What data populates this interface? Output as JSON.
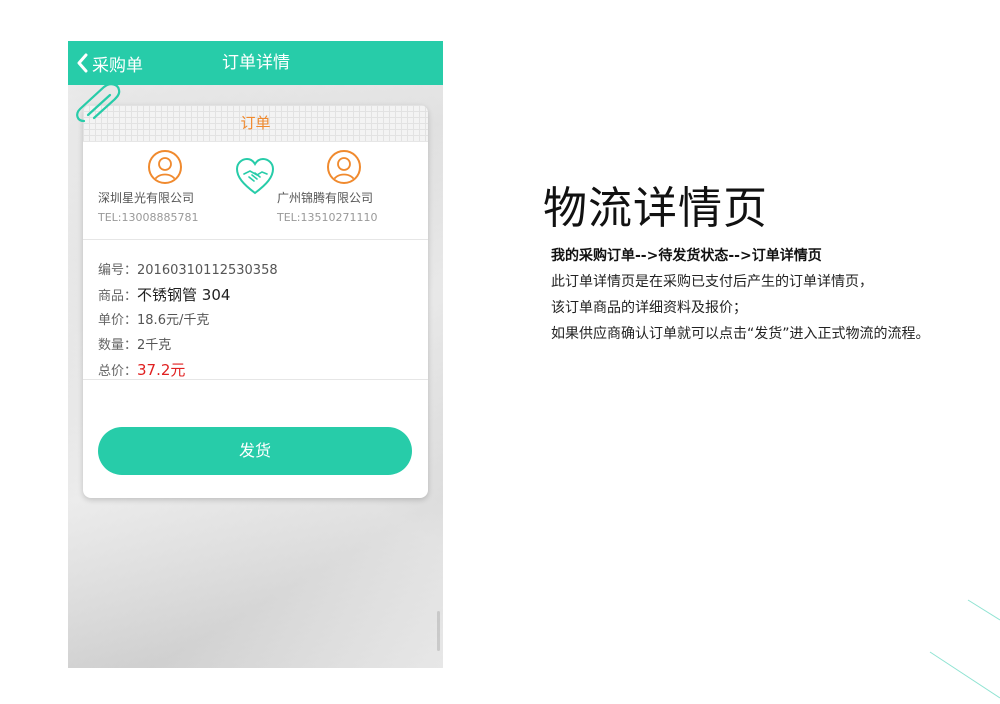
{
  "colors": {
    "brand_teal": "#27cca9",
    "accent_orange": "#f08a2e",
    "price_red": "#e02020"
  },
  "phone": {
    "navbar": {
      "back_icon": "chevron-left-icon",
      "back_label": "采购单",
      "title": "订单详情"
    },
    "card": {
      "header": "订单",
      "seller": {
        "icon": "user-avatar-icon",
        "name": "深圳星光有限公司",
        "tel": "TEL:13008885781"
      },
      "buyer": {
        "icon": "user-avatar-icon",
        "name": "广州锦腾有限公司",
        "tel": "TEL:13510271110"
      },
      "center_icon": "handshake-heart-icon",
      "details": {
        "number_label": "编号：",
        "number_value": "20160310112530358",
        "product_label": "商品：",
        "product_value": "不锈钢管 304",
        "unit_price_label": "单价：",
        "unit_price_value": "18.6元/千克",
        "quantity_label": "数量：",
        "quantity_value": "2千克",
        "total_label": "总价：",
        "total_value": "37.2元"
      },
      "ship_button": "发货"
    }
  },
  "description": {
    "heading": "物流详情页",
    "lines": [
      "我的采购订单-->待发货状态-->订单详情页",
      "此订单详情页是在采购已支付后产生的订单详情页，",
      "该订单商品的详细资料及报价；",
      "如果供应商确认订单就可以点击“发货”进入正式物流的流程。"
    ]
  }
}
